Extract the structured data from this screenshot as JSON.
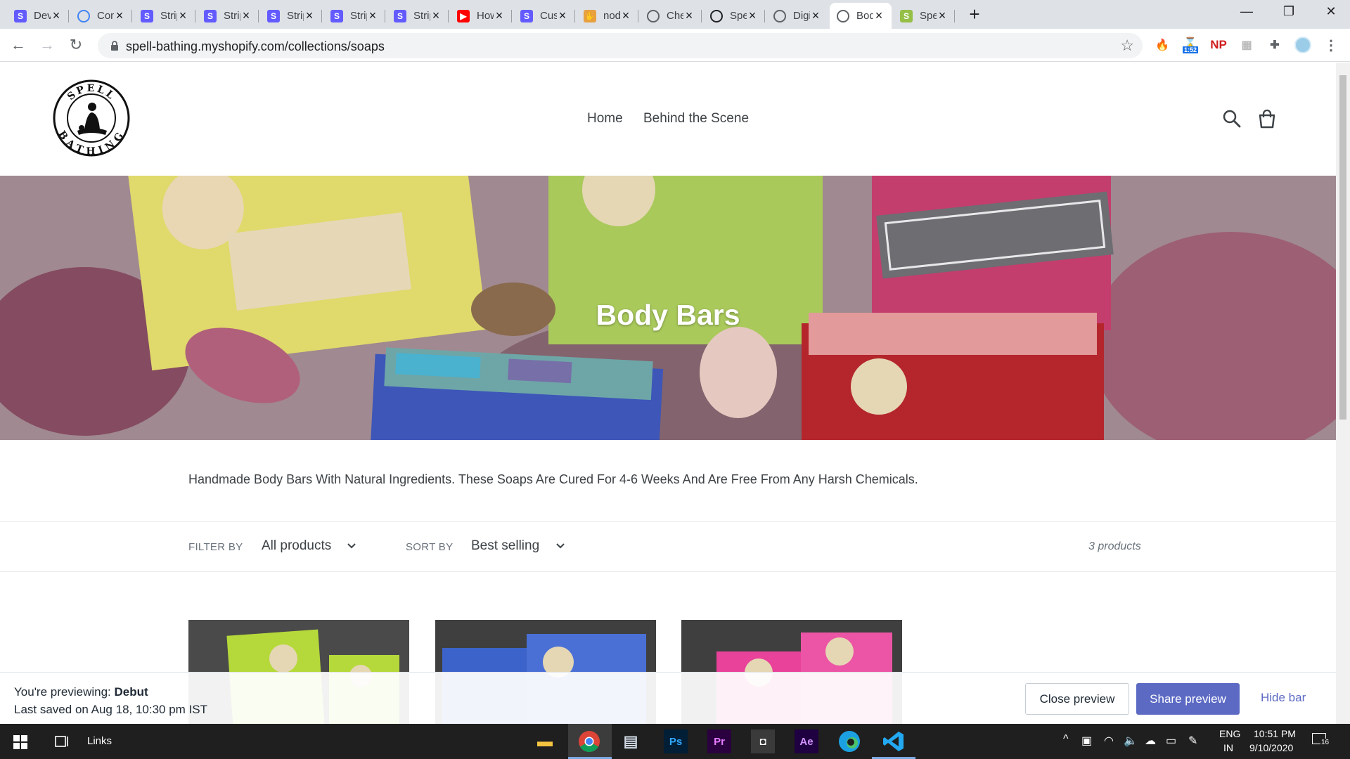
{
  "browser": {
    "tabs": [
      {
        "label": "Dev",
        "favicon": "stripe-icon",
        "color": "#635bff",
        "letter": "S"
      },
      {
        "label": "Con",
        "favicon": "loading-icon",
        "color": "#4285f4",
        "letter": ""
      },
      {
        "label": "Strip",
        "favicon": "stripe-icon",
        "color": "#635bff",
        "letter": "S"
      },
      {
        "label": "Strip",
        "favicon": "stripe-icon",
        "color": "#635bff",
        "letter": "S"
      },
      {
        "label": "Strip",
        "favicon": "stripe-icon",
        "color": "#635bff",
        "letter": "S"
      },
      {
        "label": "Strip",
        "favicon": "stripe-icon",
        "color": "#635bff",
        "letter": "S"
      },
      {
        "label": "Strip",
        "favicon": "stripe-icon",
        "color": "#635bff",
        "letter": "S"
      },
      {
        "label": "How",
        "favicon": "youtube-icon",
        "color": "#ff0000",
        "letter": "▶"
      },
      {
        "label": "Cust",
        "favicon": "stripe-icon",
        "color": "#635bff",
        "letter": "S"
      },
      {
        "label": "nod",
        "favicon": "hand-icon",
        "color": "#e8a040",
        "letter": "✋"
      },
      {
        "label": "Che",
        "favicon": "globe-icon",
        "color": "#5f6368",
        "letter": ""
      },
      {
        "label": "Spel",
        "favicon": "spell-bathing-icon",
        "color": "#202124",
        "letter": ""
      },
      {
        "label": "Digi",
        "favicon": "globe-icon",
        "color": "#5f6368",
        "letter": ""
      },
      {
        "label": "Bod",
        "favicon": "globe-icon",
        "color": "#5f6368",
        "letter": "",
        "active": true
      },
      {
        "label": "Spel",
        "favicon": "shopify-icon",
        "color": "#95bf47",
        "letter": "S"
      }
    ],
    "url": "spell-bathing.myshopify.com/collections/soaps",
    "extensions": [
      "fire-icon",
      "timer-extension-icon",
      "np-extension-icon",
      "grid-extension-icon",
      "puzzle-icon",
      "profile-avatar"
    ],
    "timer_badge": "1:52",
    "np_label": "NP"
  },
  "store": {
    "logo_text_top": "SPELL",
    "logo_text_bottom": "BATHING",
    "nav": [
      "Home",
      "Behind the Scene"
    ],
    "hero_title": "Body Bars",
    "description": "Handmade Body Bars With Natural Ingredients. These Soaps Are Cured For 4-6 Weeks And Are Free From Any Harsh Chemicals.",
    "filter_label": "FILTER BY",
    "filter_value": "All products",
    "sort_label": "SORT BY",
    "sort_value": "Best selling",
    "product_count": "3 products",
    "products": [
      {
        "color": "#b5d93a"
      },
      {
        "color": "#3c63c9"
      },
      {
        "color": "#e8429a"
      }
    ]
  },
  "preview_bar": {
    "line1_prefix": "You're previewing:",
    "theme": "Debut",
    "line2": "Last saved on Aug 18, 10:30 pm IST",
    "close": "Close preview",
    "share": "Share preview",
    "hide": "Hide bar"
  },
  "taskbar": {
    "links_label": "Links",
    "lang_line1": "ENG",
    "lang_line2": "IN",
    "time": "10:51 PM",
    "date": "9/10/2020",
    "notification_count": "16"
  }
}
